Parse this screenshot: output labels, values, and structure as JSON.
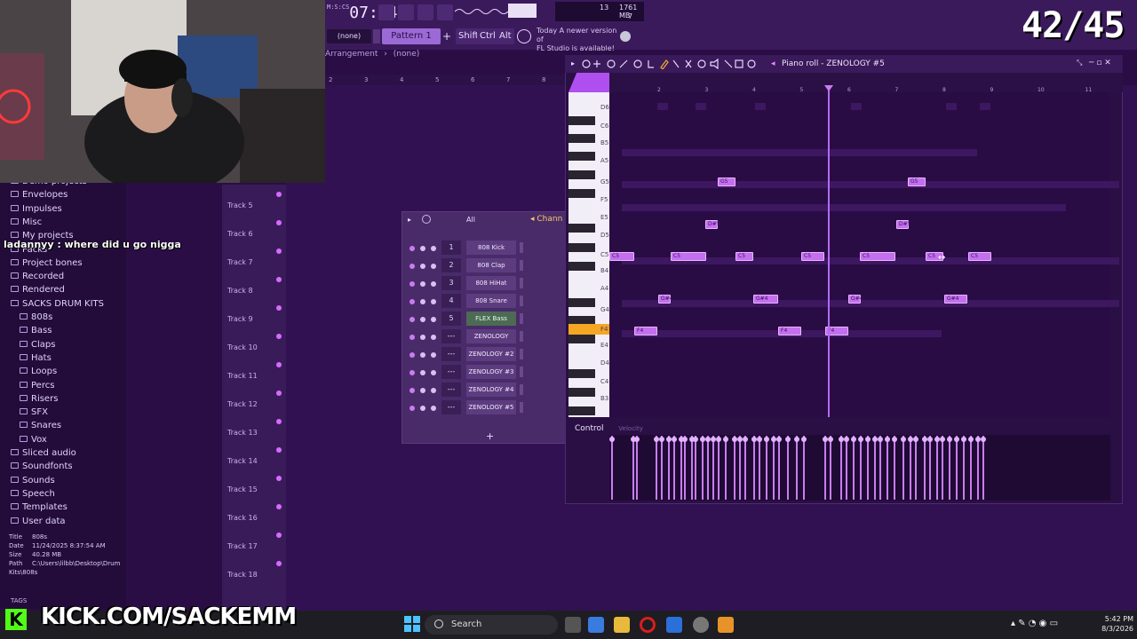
{
  "toolbar": {
    "time": "07:84",
    "time_unit": "M:S:CS",
    "cpu": "13",
    "ram": "1761 MB",
    "voices": "7",
    "pattern_select": "(none)",
    "pattern_label": "Pattern 1",
    "shift_label": "Shift",
    "ctrl_label": "Ctrl",
    "alt_label": "Alt",
    "notice_line1": "Today  A newer version of",
    "notice_line2": "FL Studio is available!"
  },
  "score": "42/45",
  "chat_message": "ladannyy : where did u go nigga",
  "browser": {
    "items": [
      {
        "label": "Demo projects",
        "top": 0
      },
      {
        "label": "Envelopes"
      },
      {
        "label": "Impulses"
      },
      {
        "label": "Misc"
      },
      {
        "label": "My projects"
      },
      {
        "label": "Packs"
      },
      {
        "label": "Project bones"
      },
      {
        "label": "Recorded"
      },
      {
        "label": "Rendered"
      },
      {
        "label": "SACKS DRUM KITS"
      }
    ],
    "sub_items": [
      "808s",
      "Bass",
      "Claps",
      "Hats",
      "Loops",
      "Percs",
      "Risers",
      "SFX",
      "Snares",
      "Vox"
    ],
    "items_after": [
      "Sliced audio",
      "Soundfonts",
      "Sounds",
      "Speech",
      "Templates",
      "User data"
    ],
    "info": {
      "title_label": "Title",
      "title": "808s",
      "date_label": "Date",
      "date": "11/24/2025 8:37:54 AM",
      "size_label": "Size",
      "size": "40.28 MB",
      "path_label": "Path",
      "path": "C:\\Users\\lilbb\\Desktop\\Drum Kits\\808s"
    },
    "tags_label": "TAGS"
  },
  "arrangement": {
    "label": "Arrangement",
    "selection": "(none)",
    "ruler": [
      "2",
      "3",
      "4",
      "5",
      "6",
      "7",
      "8"
    ],
    "tracks": [
      "Track 5",
      "Track 6",
      "Track 7",
      "Track 8",
      "Track 9",
      "Track 10",
      "Track 11",
      "Track 12",
      "Track 13",
      "Track 14",
      "Track 15",
      "Track 16",
      "Track 17",
      "Track 18"
    ]
  },
  "channel_rack": {
    "filter": "All",
    "title": "Chann",
    "channels": [
      {
        "num": "1",
        "name": "808 Kick"
      },
      {
        "num": "2",
        "name": "808 Clap"
      },
      {
        "num": "3",
        "name": "808 HiHat"
      },
      {
        "num": "4",
        "name": "808 Snare"
      },
      {
        "num": "5",
        "name": "FLEX Bass"
      },
      {
        "num": "---",
        "name": "ZENOLOGY"
      },
      {
        "num": "---",
        "name": "ZENOLOGY #2"
      },
      {
        "num": "---",
        "name": "ZENOLOGY #3"
      },
      {
        "num": "---",
        "name": "ZENOLOGY #4"
      },
      {
        "num": "---",
        "name": "ZENOLOGY #5"
      }
    ],
    "add_label": "+"
  },
  "piano_roll": {
    "title": "Piano roll - ZENOLOGY #5",
    "ruler": [
      "2",
      "3",
      "4",
      "5",
      "6",
      "7",
      "8",
      "9",
      "10",
      "11"
    ],
    "key_labels": [
      "D6",
      "C6",
      "B5",
      "A5",
      "G5",
      "F5",
      "E5",
      "D5",
      "C5",
      "B4",
      "A4",
      "G4",
      "F4",
      "E4",
      "D4",
      "C4",
      "B3"
    ],
    "notes": [
      {
        "label": "G5"
      },
      {
        "label": "G5"
      },
      {
        "label": "D#5"
      },
      {
        "label": "D#5"
      },
      {
        "label": "C5"
      },
      {
        "label": "C5"
      },
      {
        "label": "C5"
      },
      {
        "label": "C5"
      },
      {
        "label": "C5"
      },
      {
        "label": "C5"
      },
      {
        "label": "C5"
      },
      {
        "label": "G#4"
      },
      {
        "label": "G#4"
      },
      {
        "label": "G#4"
      },
      {
        "label": "G#4"
      },
      {
        "label": "F4"
      },
      {
        "label": "F4"
      },
      {
        "label": "F4"
      }
    ],
    "control_label": "Control",
    "control_value": "Velocity"
  },
  "overlay": {
    "kick_logo": "K",
    "kick_text": "KICK.COM/SACKEMM"
  },
  "taskbar": {
    "search": "Search",
    "time": "5:42 PM",
    "date": "8/3/2026"
  },
  "colors": {
    "accent": "#c46ff0",
    "background": "#2a0d45",
    "kick_green": "#53fc18"
  }
}
